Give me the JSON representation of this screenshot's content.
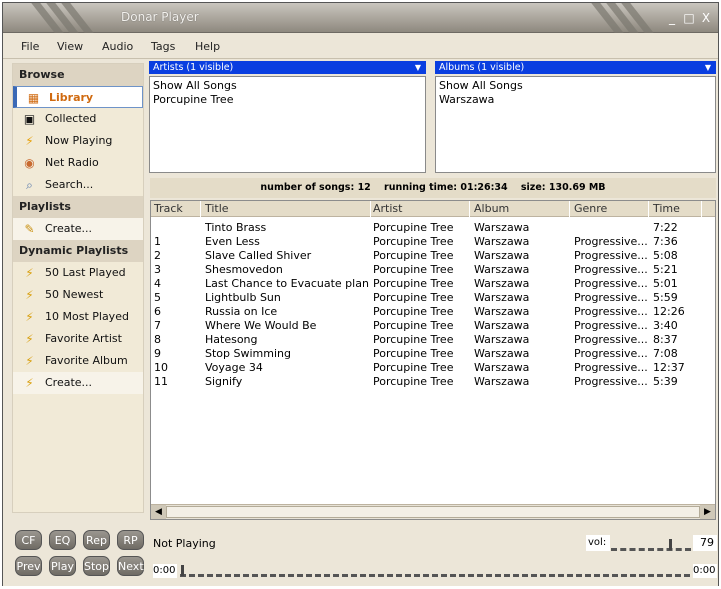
{
  "window": {
    "title": "Donar Player",
    "controls": [
      "_",
      "□",
      "X"
    ]
  },
  "menu": [
    "File",
    "View",
    "Audio",
    "Tags",
    "Help"
  ],
  "sidebar": {
    "browse_title": "Browse",
    "browse_items": [
      {
        "label": "Library",
        "icon": "library-icon"
      },
      {
        "label": "Collected",
        "icon": "disk-icon"
      },
      {
        "label": "Now Playing",
        "icon": "lightning-icon"
      },
      {
        "label": "Net Radio",
        "icon": "radio-icon"
      },
      {
        "label": "Search...",
        "icon": "search-icon"
      }
    ],
    "playlists_title": "Playlists",
    "playlist_items": [
      {
        "label": "Create...",
        "icon": "pencil-icon"
      }
    ],
    "dynamic_title": "Dynamic Playlists",
    "dynamic_items": [
      {
        "label": "50 Last Played",
        "icon": "lightning-doc-icon"
      },
      {
        "label": "50 Newest",
        "icon": "lightning-doc-icon"
      },
      {
        "label": "10 Most Played",
        "icon": "lightning-doc-icon"
      },
      {
        "label": "Favorite Artist",
        "icon": "lightning-doc-icon"
      },
      {
        "label": "Favorite Album",
        "icon": "lightning-doc-icon"
      },
      {
        "label": "Create...",
        "icon": "lightning-doc-icon"
      }
    ]
  },
  "artists": {
    "header": "Artists (1 visible)",
    "items": [
      "Show All Songs",
      "Porcupine Tree"
    ]
  },
  "albums": {
    "header": "Albums (1 visible)",
    "items": [
      "Show All Songs",
      "Warszawa"
    ]
  },
  "stats": {
    "songs_label": "number of songs:",
    "songs": "12",
    "time_label": "running time:",
    "time": "01:26:34",
    "size_label": "size:",
    "size": "130.69 MB"
  },
  "table": {
    "columns": [
      "Track",
      "Title",
      "Artist",
      "Album",
      "Genre",
      "Time"
    ],
    "rows": [
      [
        "",
        "Tinto Brass",
        "Porcupine Tree",
        "Warszawa",
        "",
        "7:22"
      ],
      [
        "1",
        "Even Less",
        "Porcupine Tree",
        "Warszawa",
        "Progressive...",
        "7:36"
      ],
      [
        "2",
        "Slave Called Shiver",
        "Porcupine Tree",
        "Warszawa",
        "Progressive...",
        "5:08"
      ],
      [
        "3",
        "Shesmovedon",
        "Porcupine Tree",
        "Warszawa",
        "Progressive...",
        "5:21"
      ],
      [
        "4",
        "Last Chance to Evacuate plan...",
        "Porcupine Tree",
        "Warszawa",
        "Progressive...",
        "5:01"
      ],
      [
        "5",
        "Lightbulb Sun",
        "Porcupine Tree",
        "Warszawa",
        "Progressive...",
        "5:59"
      ],
      [
        "6",
        "Russia on Ice",
        "Porcupine Tree",
        "Warszawa",
        "Progressive...",
        "12:26"
      ],
      [
        "7",
        "Where We Would Be",
        "Porcupine Tree",
        "Warszawa",
        "Progressive...",
        "3:40"
      ],
      [
        "8",
        "Hatesong",
        "Porcupine Tree",
        "Warszawa",
        "Progressive...",
        "8:37"
      ],
      [
        "9",
        "Stop Swimming",
        "Porcupine Tree",
        "Warszawa",
        "Progressive...",
        "7:08"
      ],
      [
        "10",
        "Voyage 34",
        "Porcupine Tree",
        "Warszawa",
        "Progressive...",
        "12:37"
      ],
      [
        "11",
        "Signify",
        "Porcupine Tree",
        "Warszawa",
        "Progressive...",
        "5:39"
      ]
    ]
  },
  "controls": {
    "top_buttons": [
      "CF",
      "EQ",
      "Rep",
      "RP"
    ],
    "bottom_buttons": [
      "Prev",
      "Play",
      "Stop",
      "Next"
    ],
    "status": "Not Playing",
    "vol_label": "vol:",
    "volume": "79",
    "position_start": "0:00",
    "position_end": "0:00"
  },
  "colors": {
    "accent": "#0a3ee0",
    "active_text": "#d06a10"
  }
}
